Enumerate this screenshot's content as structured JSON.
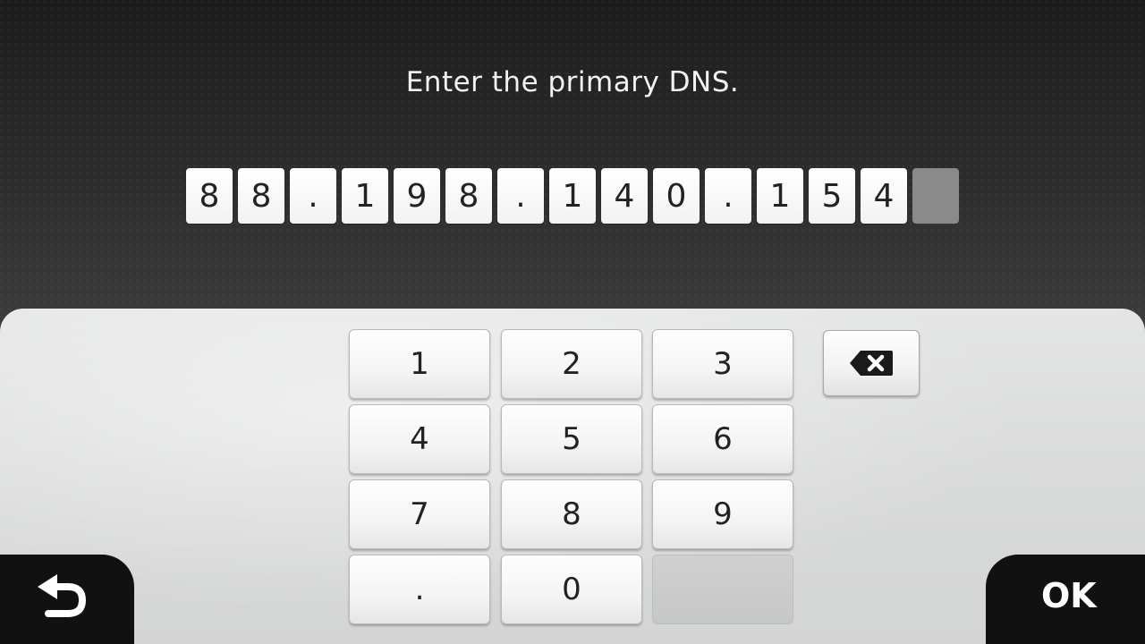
{
  "prompt": "Enter the primary DNS.",
  "entry": {
    "characters": [
      "8",
      "8",
      ".",
      "1",
      "9",
      "8",
      ".",
      "1",
      "4",
      "0",
      ".",
      "1",
      "5",
      "4"
    ]
  },
  "keypad": {
    "keys": [
      "1",
      "2",
      "3",
      "4",
      "5",
      "6",
      "7",
      "8",
      "9",
      ".",
      "0",
      ""
    ]
  },
  "buttons": {
    "backspace_icon": "backspace-icon",
    "back_icon": "return-arrow-icon",
    "ok_label": "OK"
  }
}
